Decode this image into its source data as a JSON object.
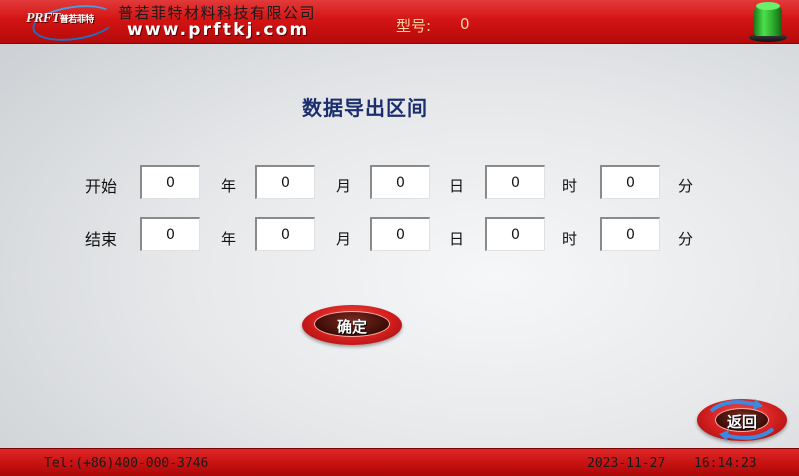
{
  "header": {
    "logo_text": "PRFT",
    "logo_cn": "普若菲特",
    "company_name": "普若菲特材料科技有限公司",
    "company_url": "www.prftkj.com",
    "model_label": "型号:",
    "model_value": "0",
    "status_color": "#2aa82a"
  },
  "main": {
    "title": "数据导出区间",
    "start": {
      "label": "开始",
      "year": "0",
      "month": "0",
      "day": "0",
      "hour": "0",
      "minute": "0"
    },
    "end": {
      "label": "结束",
      "year": "0",
      "month": "0",
      "day": "0",
      "hour": "0",
      "minute": "0"
    },
    "units": {
      "year": "年",
      "month": "月",
      "day": "日",
      "hour": "时",
      "minute": "分"
    },
    "confirm_label": "确定",
    "back_label": "返回"
  },
  "footer": {
    "phone": "Tel:(+86)400-000-3746",
    "date": "2023-11-27",
    "time": "16:14:23"
  },
  "colors": {
    "accent_red": "#d41414",
    "title_blue": "#1c2e6e"
  }
}
